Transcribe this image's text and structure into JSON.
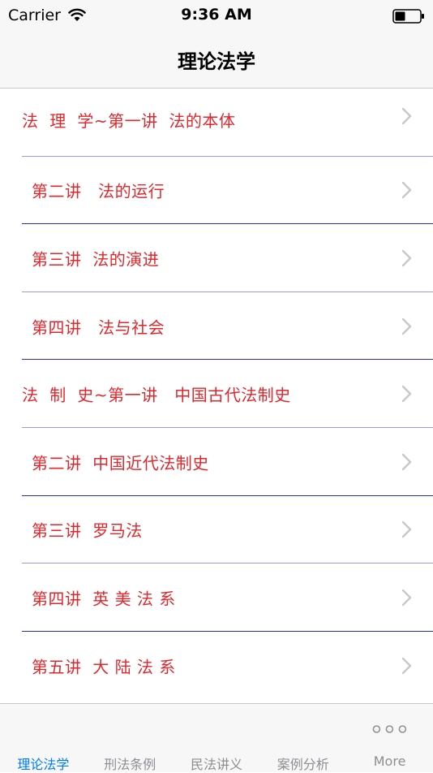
{
  "status_bar": {
    "carrier": "Carrier",
    "time": "9:36 AM"
  },
  "nav": {
    "title": "理论法学"
  },
  "colors": {
    "item_text": "#e2262b",
    "tint": "#007aff",
    "separator_a": "#9a9af0",
    "separator_b": "#2a2ad0"
  },
  "list": {
    "items": [
      {
        "label": "法  理  学~第一讲  法的本体"
      },
      {
        "label": "第二讲   法的运行"
      },
      {
        "label": "第三讲  法的演进"
      },
      {
        "label": "第四讲   法与社会"
      },
      {
        "label": "法  制  史~第一讲   中国古代法制史"
      },
      {
        "label": "第二讲  中国近代法制史"
      },
      {
        "label": "第三讲  罗马法"
      },
      {
        "label": "第四讲  英 美 法 系"
      },
      {
        "label": "第五讲  大 陆 法 系"
      }
    ]
  },
  "tab_bar": {
    "tabs": [
      {
        "label": "理论法学"
      },
      {
        "label": "刑法条例"
      },
      {
        "label": "民法讲义"
      },
      {
        "label": "案例分析"
      },
      {
        "label": "More"
      }
    ]
  }
}
